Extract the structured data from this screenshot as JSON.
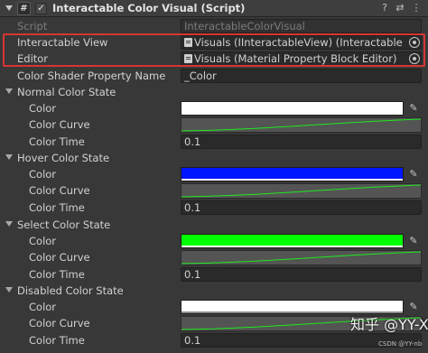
{
  "header": {
    "hash_glyph": "#",
    "enabled_glyph": "✓",
    "title": "Interactable Color Visual (Script)",
    "help_glyph": "?",
    "presets_glyph": "⇄",
    "menu_glyph": "⋮"
  },
  "script": {
    "label": "Script",
    "value": "InteractableColorVisual"
  },
  "interactable_view": {
    "label": "Interactable View",
    "value": "Visuals (IInteractableView) (Interactable Gro"
  },
  "editor": {
    "label": "Editor",
    "value": "Visuals (Material Property Block Editor)"
  },
  "shader_property": {
    "label": "Color Shader Property Name",
    "value": "_Color"
  },
  "sub_labels": {
    "color": "Color",
    "curve": "Color Curve",
    "time": "Color Time"
  },
  "dropper_glyph": "✎",
  "states": [
    {
      "title": "Normal Color State",
      "color": "#ffffff",
      "alpha_bar": "#ffffff",
      "time": "0.1"
    },
    {
      "title": "Hover Color State",
      "color": "#0015ff",
      "alpha_bar": "#ffffff",
      "time": "0.1"
    },
    {
      "title": "Select Color State",
      "color": "#00ff00",
      "alpha_bar": "#ffffff",
      "time": "0.1"
    },
    {
      "title": "Disabled Color State",
      "color": "#ffffff",
      "alpha_bar": "#8a8a8a",
      "time": "0.1"
    }
  ],
  "curve_color": "#1fe81f",
  "watermark": {
    "main": "知乎 @YY-XR",
    "sub": "CSDN @YY-nb"
  }
}
